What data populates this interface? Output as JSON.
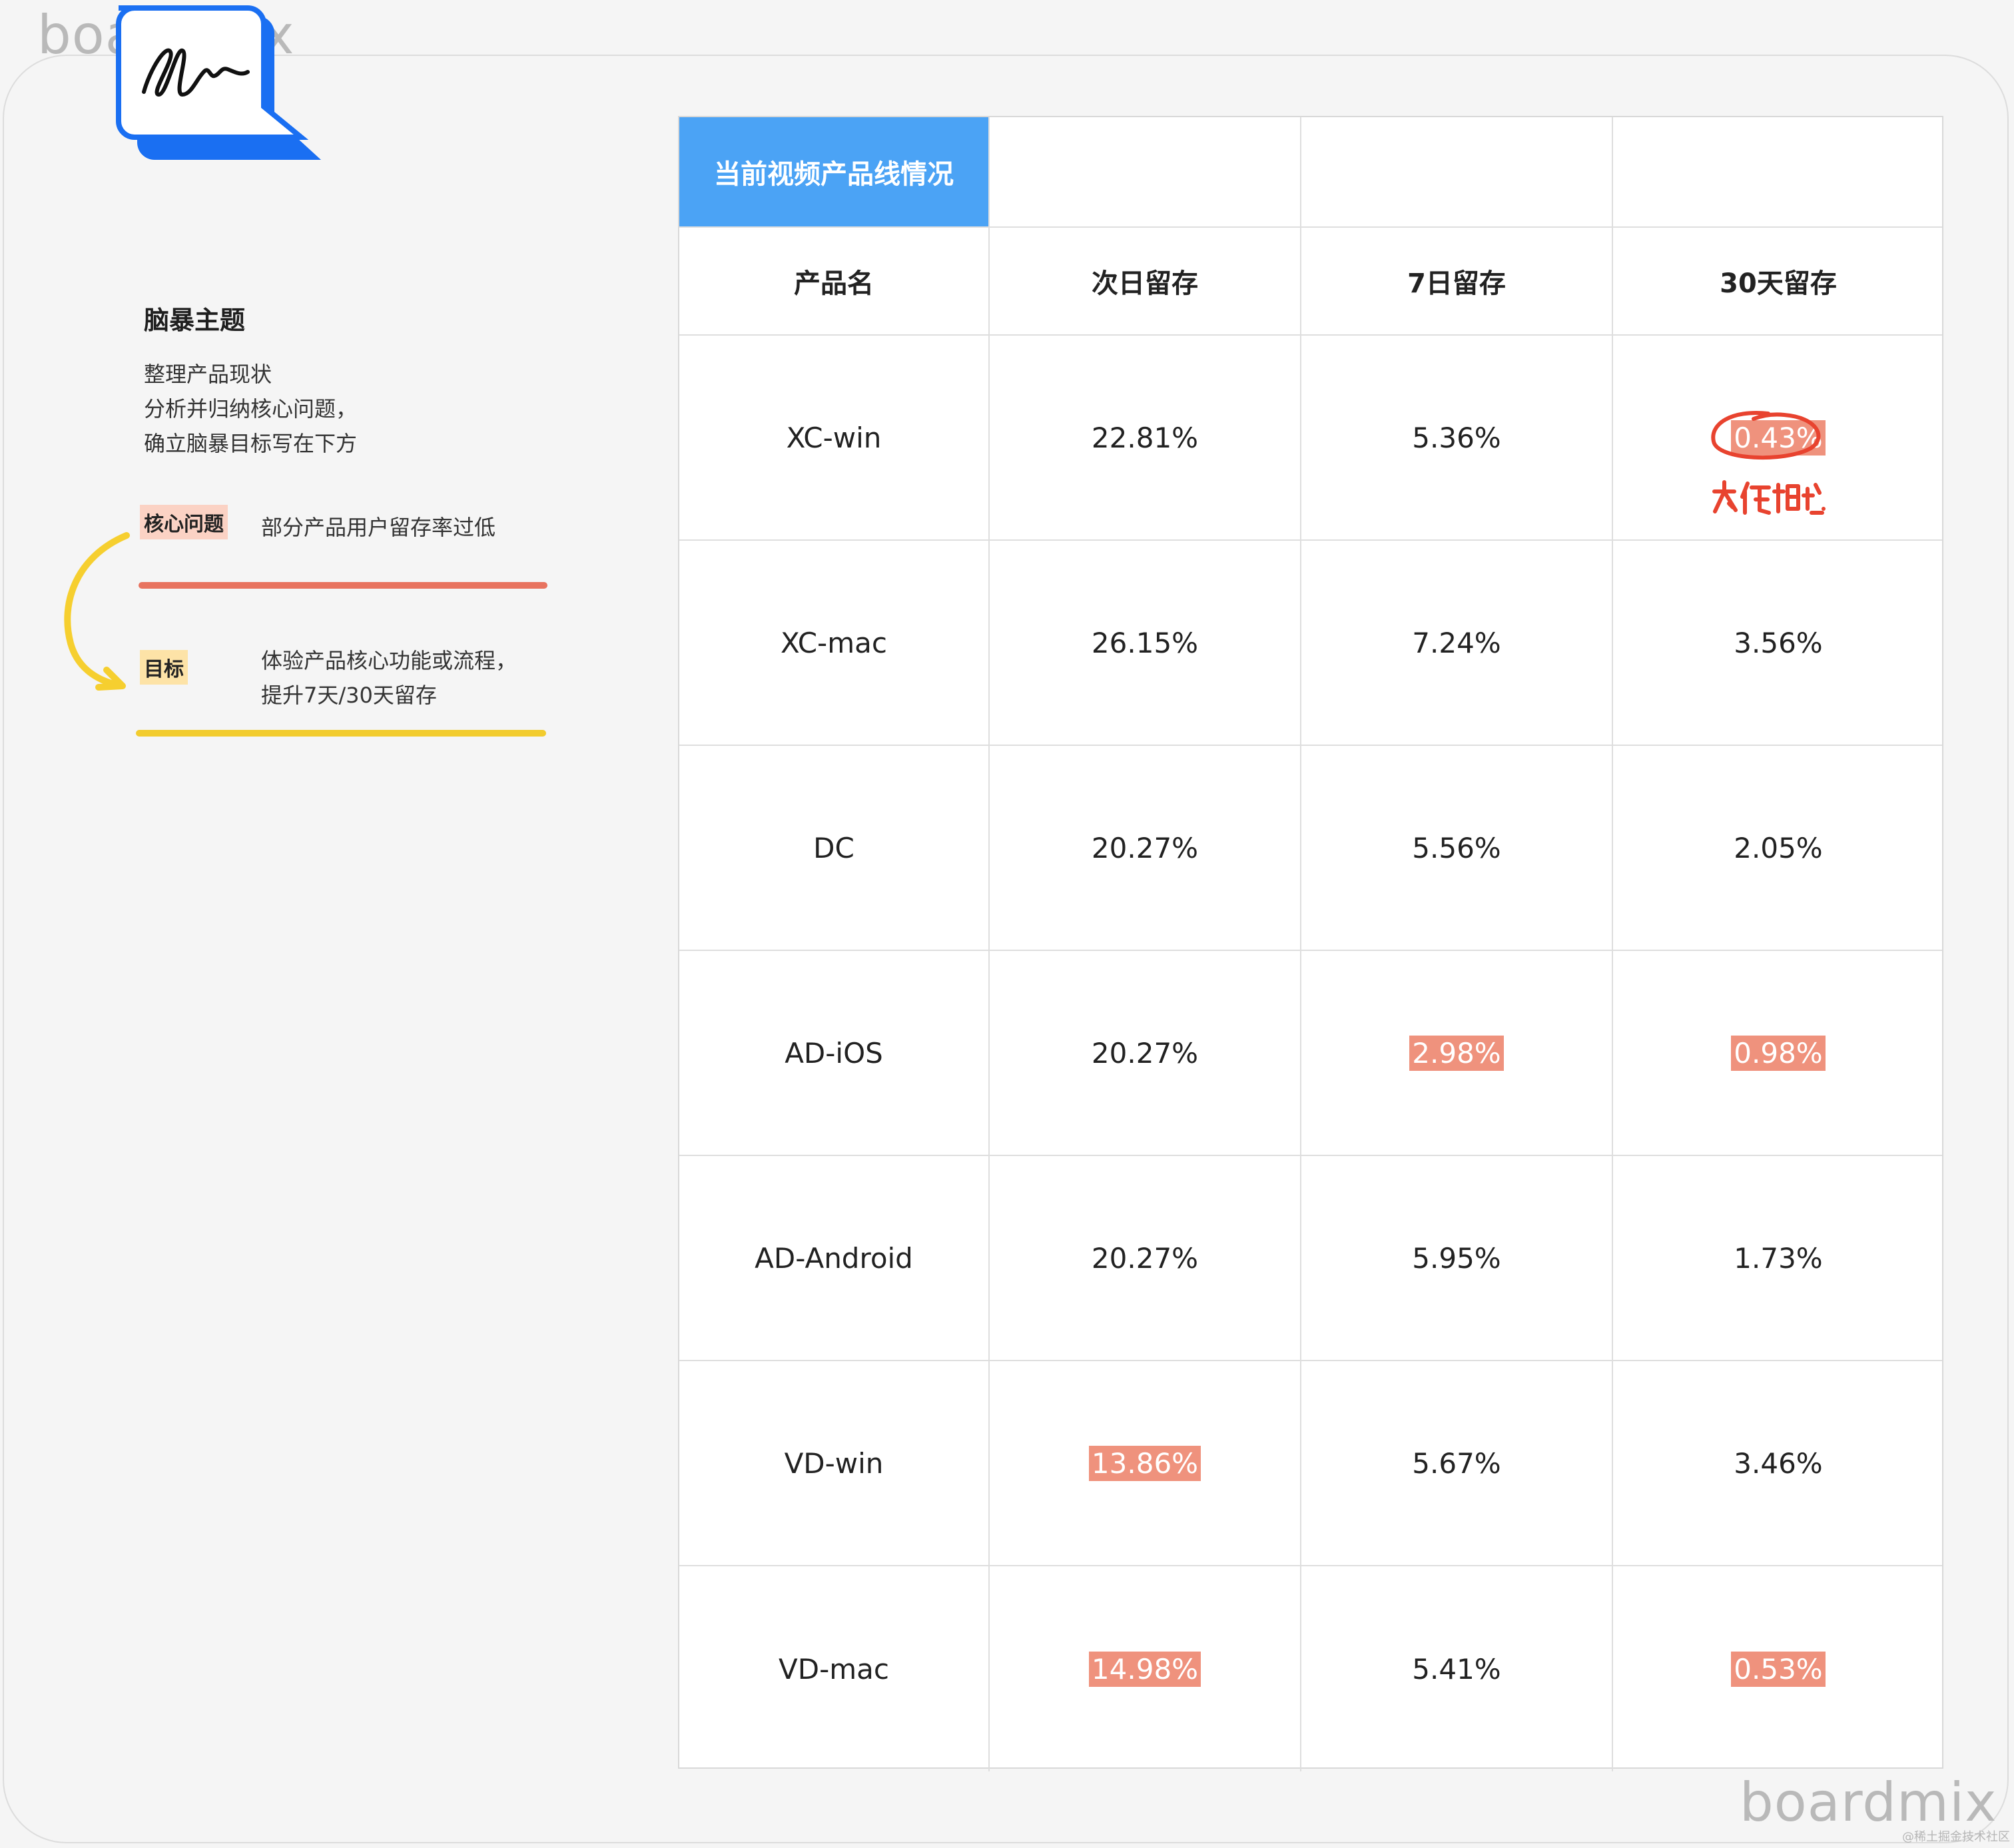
{
  "watermark": {
    "top": "boardmix",
    "bottom": "boardmix"
  },
  "footer_credit": "@稀土掘金技术社区",
  "colors": {
    "header_blue": "#4ba3f5",
    "highlight_salmon": "#ef927d",
    "problem_red": "#e8735f",
    "goal_yellow": "#f2cc2e",
    "annotation_red": "#e8432f"
  },
  "brainstorm": {
    "title": "脑暴主题",
    "description": [
      "整理产品现状",
      "分析并归纳核心问题，",
      "确立脑暴目标写在下方"
    ],
    "core_problem": {
      "tag": "核心问题",
      "text": "部分产品用户留存率过低"
    },
    "goal": {
      "tag": "目标",
      "lines": [
        "体验产品核心功能或流程，",
        "提升7天/30天留存"
      ]
    }
  },
  "table": {
    "title": "当前视频产品线情况",
    "headers": [
      "产品名",
      "次日留存",
      "7日留存",
      "30天留存"
    ],
    "rows": [
      [
        "XC-win",
        "22.81%",
        "5.36%",
        "0.43%"
      ],
      [
        "XC-mac",
        "26.15%",
        "7.24%",
        "3.56%"
      ],
      [
        "DC",
        "20.27%",
        "5.56%",
        "2.05%"
      ],
      [
        "AD-iOS",
        "20.27%",
        "2.98%",
        "0.98%"
      ],
      [
        "AD-Android",
        "20.27%",
        "5.95%",
        "1.73%"
      ],
      [
        "VD-win",
        "13.86%",
        "5.67%",
        "3.46%"
      ],
      [
        "VD-mac",
        "14.98%",
        "5.41%",
        "0.53%"
      ]
    ],
    "highlighted_cells": [
      "0.3",
      "3.2",
      "3.3",
      "5.1",
      "6.1",
      "6.3"
    ],
    "annotation": {
      "target_cell": "0.3",
      "handwritten_note": "太低啦"
    }
  }
}
